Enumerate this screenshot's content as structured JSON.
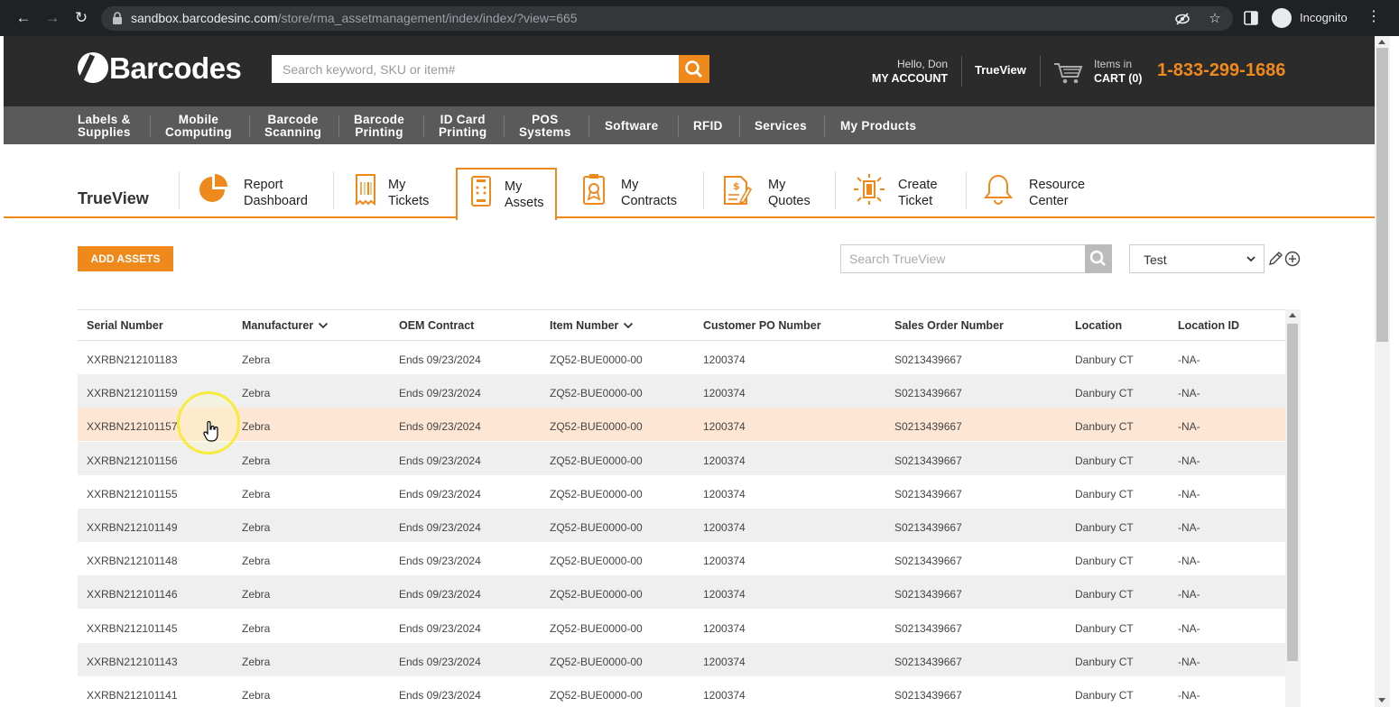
{
  "browser": {
    "url_host": "sandbox.barcodesinc.com",
    "url_path": "/store/rma_assetmanagement/index/index/?view=665",
    "profile_label": "Incognito"
  },
  "header": {
    "logo_text": "Barcodes",
    "search_placeholder": "Search keyword, SKU or item#",
    "greeting": "Hello, Don",
    "my_account": "MY ACCOUNT",
    "trueview_link": "TrueView",
    "cart_line1": "Items in",
    "cart_line2": "CART (0)",
    "phone": "1-833-299-1686"
  },
  "main_nav": [
    {
      "line1": "Labels &",
      "line2": "Supplies"
    },
    {
      "line1": "Mobile",
      "line2": "Computing"
    },
    {
      "line1": "Barcode",
      "line2": "Scanning"
    },
    {
      "line1": "Barcode",
      "line2": "Printing"
    },
    {
      "line1": "ID Card",
      "line2": "Printing"
    },
    {
      "line1": "POS",
      "line2": "Systems"
    },
    {
      "line1": "Software",
      "line2": ""
    },
    {
      "line1": "RFID",
      "line2": ""
    },
    {
      "line1": "Services",
      "line2": ""
    },
    {
      "line1": "My Products",
      "line2": ""
    }
  ],
  "trueview": {
    "title": "TrueView",
    "tabs": [
      {
        "line1": "Report",
        "line2": "Dashboard",
        "icon": "pie-chart-icon"
      },
      {
        "line1": "My",
        "line2": "Tickets",
        "icon": "ticket-icon"
      },
      {
        "line1": "My",
        "line2": "Assets",
        "icon": "device-icon",
        "active": true
      },
      {
        "line1": "My",
        "line2": "Contracts",
        "icon": "contract-icon"
      },
      {
        "line1": "My",
        "line2": "Quotes",
        "icon": "quote-icon"
      },
      {
        "line1": "Create",
        "line2": "Ticket",
        "icon": "create-ticket-icon"
      },
      {
        "line1": "Resource",
        "line2": "Center",
        "icon": "bell-icon"
      }
    ]
  },
  "toolbar": {
    "add_assets_label": "ADD ASSETS",
    "search_placeholder": "Search TrueView",
    "view_selected": "Test"
  },
  "table": {
    "columns": [
      "Serial Number",
      "Manufacturer",
      "OEM Contract",
      "Item Number",
      "Customer PO Number",
      "Sales Order Number",
      "Location",
      "Location ID"
    ],
    "rows": [
      [
        "XXRBN212101183",
        "Zebra",
        "Ends 09/23/2024",
        "ZQ52-BUE0000-00",
        "1200374",
        "S0213439667",
        "Danbury CT",
        "-NA-"
      ],
      [
        "XXRBN212101159",
        "Zebra",
        "Ends 09/23/2024",
        "ZQ52-BUE0000-00",
        "1200374",
        "S0213439667",
        "Danbury CT",
        "-NA-"
      ],
      [
        "XXRBN212101157",
        "Zebra",
        "Ends 09/23/2024",
        "ZQ52-BUE0000-00",
        "1200374",
        "S0213439667",
        "Danbury CT",
        "-NA-"
      ],
      [
        "XXRBN212101156",
        "Zebra",
        "Ends 09/23/2024",
        "ZQ52-BUE0000-00",
        "1200374",
        "S0213439667",
        "Danbury CT",
        "-NA-"
      ],
      [
        "XXRBN212101155",
        "Zebra",
        "Ends 09/23/2024",
        "ZQ52-BUE0000-00",
        "1200374",
        "S0213439667",
        "Danbury CT",
        "-NA-"
      ],
      [
        "XXRBN212101149",
        "Zebra",
        "Ends 09/23/2024",
        "ZQ52-BUE0000-00",
        "1200374",
        "S0213439667",
        "Danbury CT",
        "-NA-"
      ],
      [
        "XXRBN212101148",
        "Zebra",
        "Ends 09/23/2024",
        "ZQ52-BUE0000-00",
        "1200374",
        "S0213439667",
        "Danbury CT",
        "-NA-"
      ],
      [
        "XXRBN212101146",
        "Zebra",
        "Ends 09/23/2024",
        "ZQ52-BUE0000-00",
        "1200374",
        "S0213439667",
        "Danbury CT",
        "-NA-"
      ],
      [
        "XXRBN212101145",
        "Zebra",
        "Ends 09/23/2024",
        "ZQ52-BUE0000-00",
        "1200374",
        "S0213439667",
        "Danbury CT",
        "-NA-"
      ],
      [
        "XXRBN212101143",
        "Zebra",
        "Ends 09/23/2024",
        "ZQ52-BUE0000-00",
        "1200374",
        "S0213439667",
        "Danbury CT",
        "-NA-"
      ],
      [
        "XXRBN212101141",
        "Zebra",
        "Ends 09/23/2024",
        "ZQ52-BUE0000-00",
        "1200374",
        "S0213439667",
        "Danbury CT",
        "-NA-"
      ]
    ]
  },
  "colors": {
    "accent": "#f0891c",
    "header_bg": "#2b2b2b",
    "nav_bg": "#5a5a5a",
    "row_highlight": "#fde6d4"
  }
}
